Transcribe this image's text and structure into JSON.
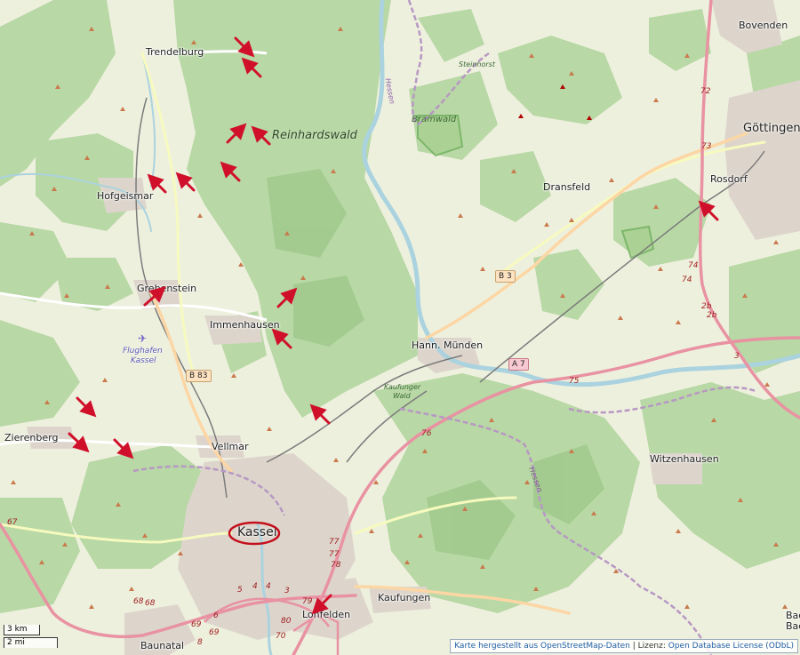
{
  "places": {
    "trendelburg": "Trendelburg",
    "hofgeismar": "Hofgeismar",
    "grebenstein": "Grebenstein",
    "immenhausen": "Immenhausen",
    "zierenberg": "Zierenberg",
    "vellmar": "Vellmar",
    "kassel": "Kassel",
    "baunatal": "Baunatal",
    "lohfelden": "Lohfelden",
    "kaufungen": "Kaufungen",
    "hann_muenden": "Hann. Münden",
    "witzenhausen": "Witzenhausen",
    "dransfeld": "Dransfeld",
    "rosdorf": "Rosdorf",
    "goettingen": "Göttingen",
    "bovenden": "Bovenden",
    "bad_edge": "Bad",
    "bad_edge2": "Bac"
  },
  "areas": {
    "reinhardswald": "Reinhardswald",
    "bramwald": "Bramwald",
    "steinhorst": "Steinhorst",
    "kaufunger_wald_1": "Kaufunger",
    "kaufunger_wald_2": "Wald"
  },
  "airport": {
    "line1": "Flughafen",
    "line2": "Kassel"
  },
  "border_labels": {
    "hessen_1": "Hessen",
    "hessen_2": "Hessen"
  },
  "roads": {
    "b3": "B 3",
    "b83": "B 83",
    "a7": "A 7",
    "exits": [
      "72",
      "73",
      "74",
      "74",
      "2b",
      "2b",
      "3",
      "75",
      "76",
      "77",
      "77",
      "78",
      "79",
      "80",
      "70",
      "69",
      "68",
      "68",
      "67",
      "6",
      "5",
      "4",
      "4",
      "3",
      "8",
      "69"
    ]
  },
  "scale": {
    "km": "3 km",
    "mi": "2 mi"
  },
  "attribution": {
    "link1": "Karte hergestellt aus OpenStreetMap-Daten",
    "separator": " | Lizenz: ",
    "link2": "Open Database License (ODbL)"
  },
  "colors": {
    "forest": "#add19e",
    "background": "#f2efe6",
    "motorway": "#e892a2",
    "trunk": "#f9b29c",
    "primary": "#fcd6a4",
    "water": "#aad3df",
    "urban": "#d9d0c9",
    "marker_arrow": "#d0102a",
    "marker_circle": "#c4101c"
  }
}
